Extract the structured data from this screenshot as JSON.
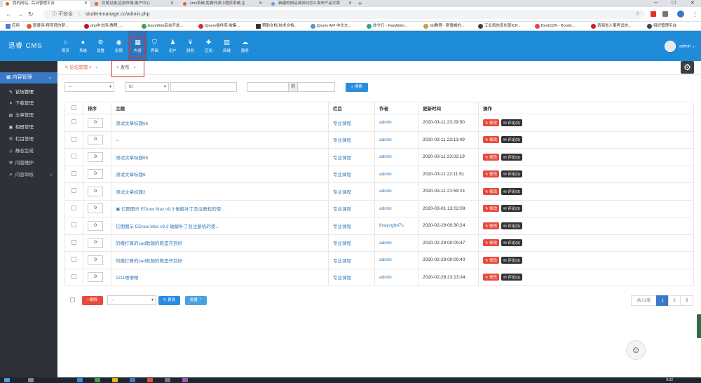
{
  "browser": {
    "tabs": [
      {
        "title": "我的网站 - 后台管理平台",
        "active": true
      },
      {
        "title": "交易记录,应用市场,用户中心",
        "active": false
      },
      {
        "title": "cms系统,免费开源小程序系统,企",
        "active": false
      },
      {
        "title": "新建的网站该如何怎么发布产品文章",
        "active": false
      }
    ],
    "new_tab": "+",
    "security": "不安全",
    "url": "studentmanage.cc/admin.php",
    "bookmarks": [
      "应用",
      "愿景网-程序员的梦...",
      "php中文网-教程_...",
      "EasyWeb后台开发...",
      "jQuery插件库-收集...",
      "帮助文档,技术文档...",
      "jQuery API 中文文...",
      "命令行 - FastAdmi...",
      "Git教程 - 廖雪峰的...",
      "工业和信息化部ICP...",
      "BootCDN - Bootst...",
      "青海省人事考试信...",
      "组织管理平台"
    ]
  },
  "header": {
    "logo": "迅睿 CMS",
    "nav": [
      {
        "label": "首页",
        "icon": "home-icon"
      },
      {
        "label": "系统",
        "icon": "globe-icon"
      },
      {
        "label": "设置",
        "icon": "cogs-icon"
      },
      {
        "label": "权限",
        "icon": "user-circle-icon"
      },
      {
        "label": "内容",
        "icon": "th-large-icon"
      },
      {
        "label": "界面",
        "icon": "shield-icon"
      },
      {
        "label": "用户",
        "icon": "user-icon"
      },
      {
        "label": "财务",
        "icon": "yen-icon"
      },
      {
        "label": "应用",
        "icon": "puzzle-icon"
      },
      {
        "label": "商城",
        "icon": "shop-icon"
      },
      {
        "label": "服务",
        "icon": "cloud-icon"
      }
    ],
    "user": "admin"
  },
  "sidebar": {
    "group": "内容管理",
    "items": [
      {
        "label": "论坛管理",
        "icon": "comments-icon"
      },
      {
        "label": "下载管理",
        "icon": "download-icon"
      },
      {
        "label": "文章管理",
        "icon": "file-icon"
      },
      {
        "label": "相册管理",
        "icon": "image-icon"
      },
      {
        "label": "栏目管理",
        "icon": "list-icon"
      },
      {
        "label": "静态生成",
        "icon": "html-icon"
      },
      {
        "label": "内容维护",
        "icon": "wrench-icon"
      },
      {
        "label": "内容审核",
        "icon": "edit-icon"
      }
    ]
  },
  "content_tabs": {
    "forum": "论坛管理",
    "publish": "发布"
  },
  "filter": {
    "category_value": "--",
    "field_value": "Id",
    "keyword": "",
    "date_sep": "到",
    "search_label": "搜索"
  },
  "table": {
    "headers": {
      "order": "排序",
      "title": "主题",
      "column": "栏目",
      "author": "作者",
      "updated": "更新时间",
      "actions": "操作"
    },
    "edit_label": "修改",
    "comment_label": "评论(0)",
    "rows": [
      {
        "order": "0",
        "title": "测试文章标题66",
        "column": "专业课程",
        "author": "admin",
        "updated": "2020-03-11 23:29:50"
      },
      {
        "order": "0",
        "title": "...",
        "column": "专业课程",
        "author": "admin",
        "updated": "2020-03-11 23:13:49"
      },
      {
        "order": "0",
        "title": "测试文章标题65",
        "column": "专业课程",
        "author": "admin",
        "updated": "2020-03-11 23:02:19"
      },
      {
        "order": "0",
        "title": "测试文章标题6",
        "column": "专业课程",
        "author": "admin",
        "updated": "2020-03-11 22:11:51"
      },
      {
        "order": "0",
        "title": "测试文章标题2",
        "column": "专业课程",
        "author": "admin",
        "updated": "2020-03-11 21:59:23"
      },
      {
        "order": "0",
        "title": "亿图图示 EDraw Max v9.3 破解补丁及注册机的使...",
        "column": "专业课程",
        "author": "admin",
        "updated": "2020-03-01 13:02:09",
        "image": true
      },
      {
        "order": "0",
        "title": "亿图图示 EDraw Max v9.3 破解补丁及注册机的使...",
        "column": "专业课程",
        "author": "6xayzgbd7s",
        "updated": "2020-02-29 00:30:24"
      },
      {
        "order": "0",
        "title": "的撒打算的sad歌颠的皓是开到好",
        "column": "专业课程",
        "author": "admin",
        "updated": "2020-02-29 00:09:47"
      },
      {
        "order": "0",
        "title": "的撒打算的sad歌颠的皓是开到好",
        "column": "专业课程",
        "author": "admin",
        "updated": "2020-02-29 00:09:40"
      },
      {
        "order": "0",
        "title": "1111嗯嗯嗯",
        "column": "专业课程",
        "author": "admin",
        "updated": "2020-02-28 23:13:34"
      }
    ]
  },
  "footer": {
    "delete_label": "删除",
    "move_value": "--",
    "change_label": "更改",
    "batch_label": "批量",
    "total": "共21条",
    "pages": [
      "1",
      "2",
      "3"
    ]
  },
  "taskbar": {
    "time": "9:32"
  }
}
